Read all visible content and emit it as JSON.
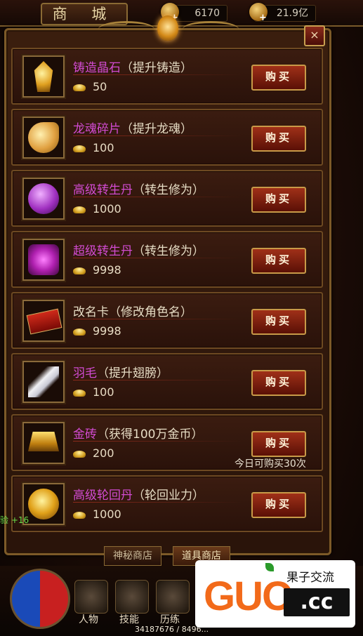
{
  "topbar": {
    "title": "商 城",
    "gold_plus": "+",
    "gold_value": "6170",
    "ingot_plus": "+",
    "ingot_value": "21.9亿"
  },
  "panel": {
    "close_label": "×"
  },
  "items": [
    {
      "name": "铸造晶石",
      "desc": "（提升铸造）",
      "price": "50",
      "button": "购买",
      "name_color": "purple",
      "icon": "crystal-icon"
    },
    {
      "name": "龙魂碎片",
      "desc": "（提升龙魂）",
      "price": "100",
      "button": "购买",
      "name_color": "purple",
      "icon": "dragon-soul-icon"
    },
    {
      "name": "高级转生丹",
      "desc": "（转生修为）",
      "price": "1000",
      "button": "购买",
      "name_color": "purple",
      "icon": "rebirth-pill-icon"
    },
    {
      "name": "超级转生丹",
      "desc": "（转生修为）",
      "price": "9998",
      "button": "购买",
      "name_color": "purple",
      "icon": "super-rebirth-pill-icon"
    },
    {
      "name": "改名卡",
      "desc": "（修改角色名）",
      "price": "9998",
      "button": "购买",
      "name_color": "white",
      "icon": "rename-card-icon"
    },
    {
      "name": "羽毛",
      "desc": "（提升翅膀）",
      "price": "100",
      "button": "购买",
      "name_color": "purple",
      "icon": "feather-icon"
    },
    {
      "name": "金砖",
      "desc": "（获得100万金币）",
      "price": "200",
      "button": "购买",
      "name_color": "purple",
      "icon": "gold-brick-icon",
      "note": "今日可购买30次"
    },
    {
      "name": "高级轮回丹",
      "desc": "（轮回业力）",
      "price": "1000",
      "button": "购买",
      "name_color": "purple",
      "icon": "reincarnation-pill-icon"
    }
  ],
  "tabs": [
    {
      "label": "神秘商店"
    },
    {
      "label": "道具商店"
    }
  ],
  "bottom": {
    "skills": [
      {
        "label": "人物"
      },
      {
        "label": "技能"
      },
      {
        "label": "历练"
      }
    ],
    "exp": "34187676 / 8496...",
    "left_tag": "验 +16"
  },
  "watermark": {
    "brand": "GUO",
    "domain": ".cc",
    "cn": "果子交流"
  },
  "colors": {
    "name_purple": "#d24bd2",
    "button_red": "#a03018",
    "frame_gold": "#7d5a28"
  }
}
